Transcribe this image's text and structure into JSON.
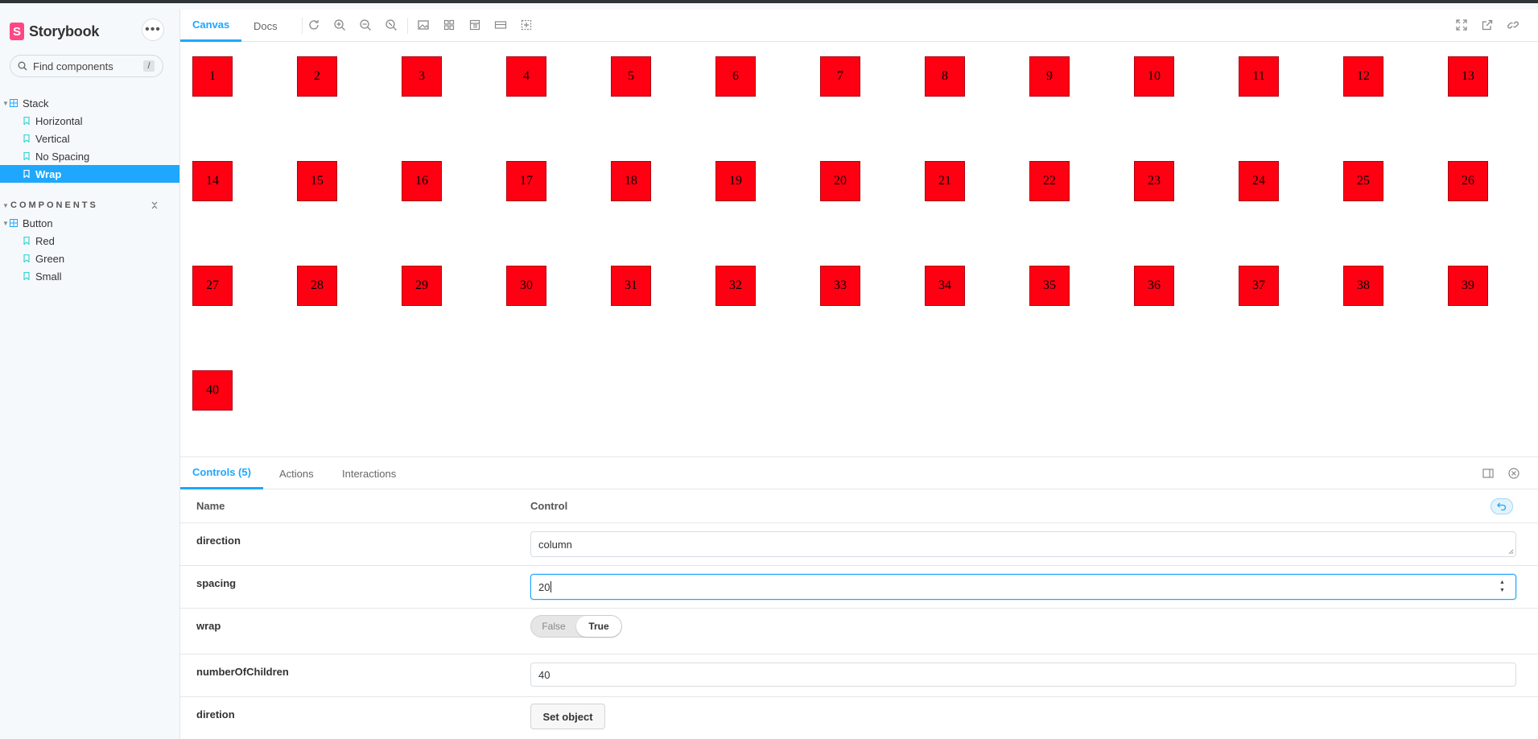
{
  "sidebar": {
    "brand": "Storybook",
    "brand_logo": "S",
    "menu_glyph": "•••",
    "search_placeholder": "Find components",
    "search_shortcut": "/",
    "stack_group": "Stack",
    "stack_stories": [
      "Horizontal",
      "Vertical",
      "No Spacing",
      "Wrap"
    ],
    "active_story": "Wrap",
    "section_label": "COMPONENTS",
    "button_group": "Button",
    "button_stories": [
      "Red",
      "Green",
      "Small"
    ]
  },
  "toolbar": {
    "tabs": [
      "Canvas",
      "Docs"
    ],
    "active_tab": "Canvas",
    "icons": [
      "reload-icon",
      "zoom-in-icon",
      "zoom-out-icon",
      "zoom-reset-icon",
      "background-icon",
      "grid-icon",
      "viewport-icon",
      "measure-icon",
      "outline-icon"
    ],
    "right_icons": [
      "fullscreen-icon",
      "open-new-tab-icon",
      "copy-link-icon"
    ]
  },
  "canvas": {
    "boxes": [
      "1",
      "2",
      "3",
      "4",
      "5",
      "6",
      "7",
      "8",
      "9",
      "10",
      "11",
      "12",
      "13",
      "14",
      "15",
      "16",
      "17",
      "18",
      "19",
      "20",
      "21",
      "22",
      "23",
      "24",
      "25",
      "26",
      "27",
      "28",
      "29",
      "30",
      "31",
      "32",
      "33",
      "34",
      "35",
      "36",
      "37",
      "38",
      "39",
      "40"
    ],
    "box_color": "#ff0013"
  },
  "addons": {
    "tabs": [
      "Controls (5)",
      "Actions",
      "Interactions"
    ],
    "active_tab": "Controls (5)",
    "col_name": "Name",
    "col_control": "Control",
    "rows": {
      "direction": {
        "name": "direction",
        "value": "column"
      },
      "spacing": {
        "name": "spacing",
        "value": "20"
      },
      "wrap": {
        "name": "wrap",
        "false_label": "False",
        "true_label": "True",
        "selected": "True"
      },
      "numberOfChildren": {
        "name": "numberOfChildren",
        "value": "40"
      },
      "diretion": {
        "name": "diretion",
        "button": "Set object"
      }
    }
  },
  "colors": {
    "accent": "#1ea7fd",
    "brand": "#ff4785"
  }
}
